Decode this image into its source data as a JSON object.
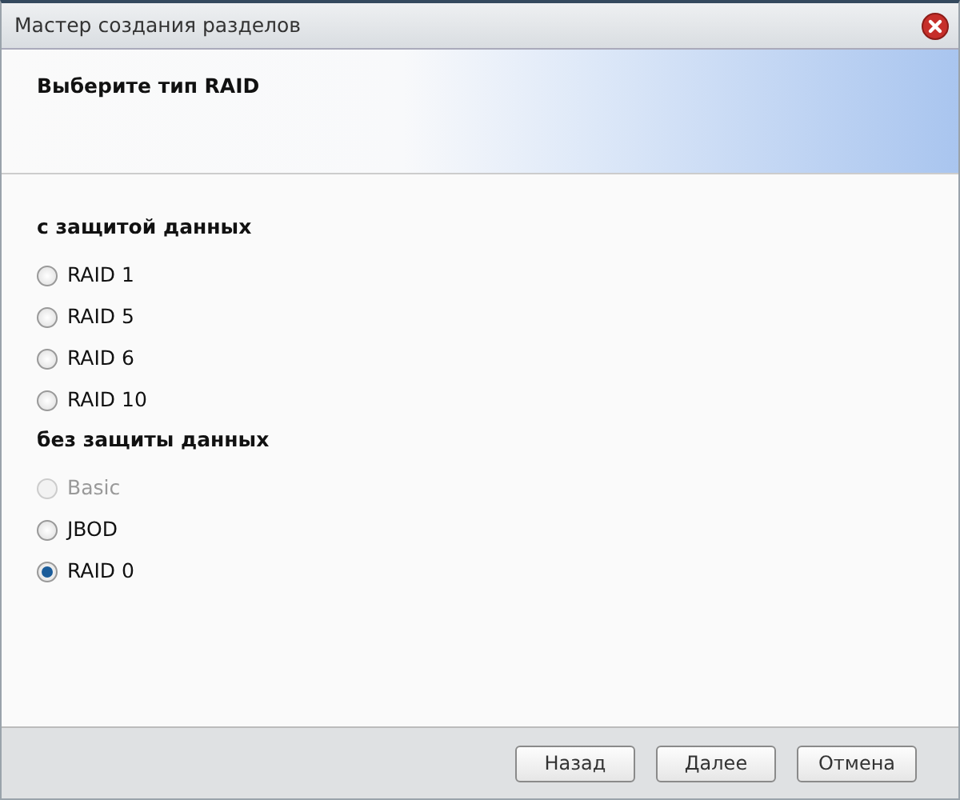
{
  "window": {
    "title": "Мастер создания разделов"
  },
  "header": {
    "title": "Выберите тип RAID"
  },
  "groups": [
    {
      "heading": "с защитой данных",
      "options": [
        {
          "label": "RAID 1",
          "selected": false,
          "disabled": false
        },
        {
          "label": "RAID 5",
          "selected": false,
          "disabled": false
        },
        {
          "label": "RAID 6",
          "selected": false,
          "disabled": false
        },
        {
          "label": "RAID 10",
          "selected": false,
          "disabled": false
        }
      ]
    },
    {
      "heading": "без защиты данных",
      "options": [
        {
          "label": "Basic",
          "selected": false,
          "disabled": true
        },
        {
          "label": "JBOD",
          "selected": false,
          "disabled": false
        },
        {
          "label": "RAID 0",
          "selected": true,
          "disabled": false
        }
      ]
    }
  ],
  "buttons": [
    "Назад",
    "Далее",
    "Отмена"
  ]
}
